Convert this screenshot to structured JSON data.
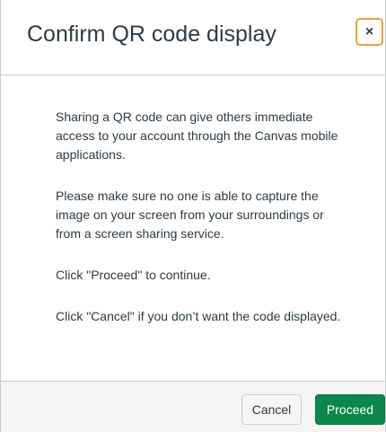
{
  "dialog": {
    "title": "Confirm QR code display",
    "close_icon": "×",
    "paragraphs": [
      "Sharing a QR code can give others immediate access to your account through the Canvas mobile applications.",
      "Please make sure no one is able to capture the image on your screen from your surroundings or from a screen sharing service.",
      "Click \"Proceed\" to continue.",
      "Click \"Cancel\" if you don’t want the code displayed."
    ],
    "buttons": {
      "cancel_label": "Cancel",
      "proceed_label": "Proceed"
    }
  },
  "colors": {
    "close_focus_ring": "#f2a13b",
    "proceed_bg": "#0b874b",
    "footer_bg": "#f5f5f5",
    "text": "#2d3b45"
  }
}
